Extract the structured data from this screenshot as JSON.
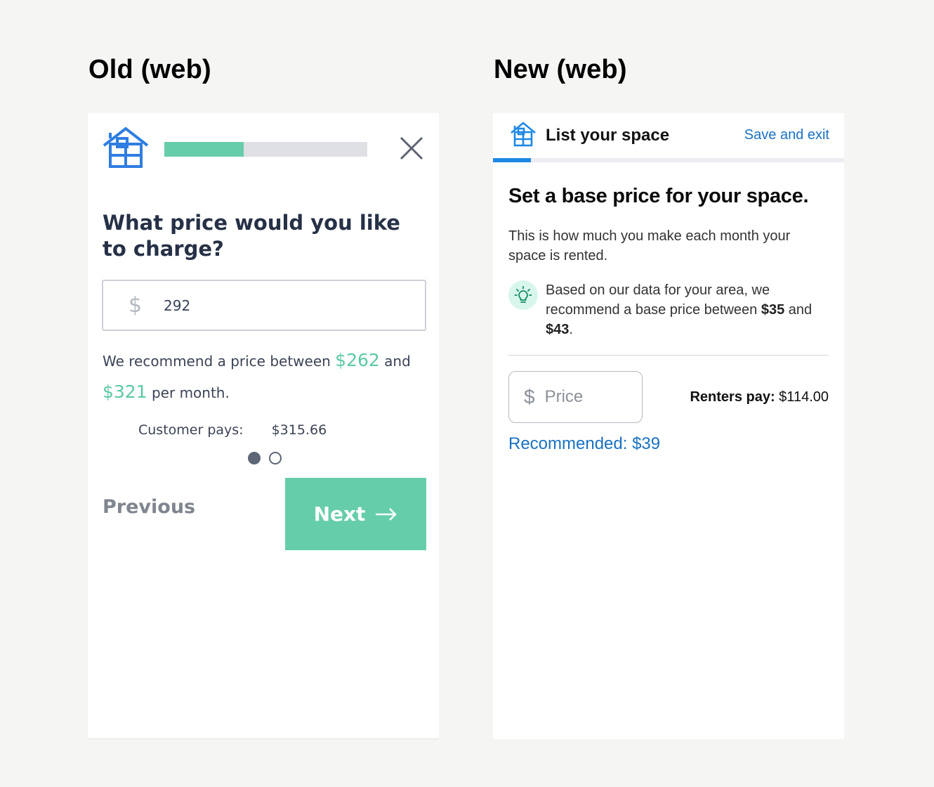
{
  "headings": {
    "old": "Old (web)",
    "new": "New (web)"
  },
  "old": {
    "progress": 0.39,
    "question": "What price would you like to charge?",
    "price_input": {
      "currency_symbol": "$",
      "value": "292"
    },
    "recommend": {
      "prefix": "We recommend a price between ",
      "low": "$262",
      "middle": " and ",
      "high": "$321",
      "suffix": " per month."
    },
    "customer_pays": {
      "label": "Customer pays:",
      "value": "$315.66"
    },
    "pagination": {
      "current": 1,
      "total": 2
    },
    "previous_label": "Previous",
    "next_label": "Next",
    "accent_color": "#66cdab"
  },
  "new": {
    "header_title": "List your space",
    "save_exit_label": "Save and exit",
    "progress": 0.107,
    "title": "Set a base price for your space.",
    "description": "This is how much you make each month your space is rented.",
    "tip": {
      "prefix": "Based on our data for your area, we recommend a base price between ",
      "low": "$35",
      "middle": " and ",
      "high": "$43",
      "suffix": "."
    },
    "price_input": {
      "currency_symbol": "$",
      "placeholder": "Price"
    },
    "renters_pay": {
      "label": "Renters pay:",
      "value": " $114.00"
    },
    "recommended": "Recommended: $39",
    "accent_color": "#1e88e5"
  }
}
